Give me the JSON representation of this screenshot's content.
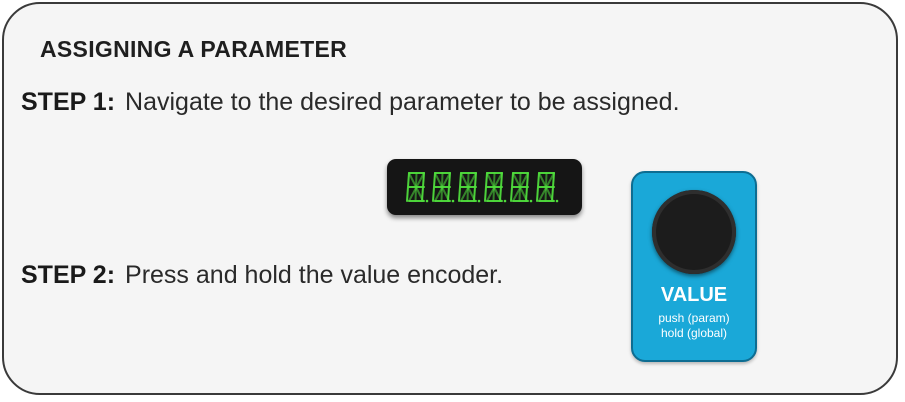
{
  "title": "ASSIGNING A PARAMETER",
  "steps": [
    {
      "label": "STEP 1:",
      "text": "Navigate to the desired parameter to be assigned."
    },
    {
      "label": "STEP 2:",
      "text": "Press and hold the value encoder."
    }
  ],
  "display": {
    "icon": "led-segment-display",
    "color": "#4fdc3c"
  },
  "encoder_module": {
    "title": "VALUE",
    "line1": "push (param)",
    "line2": "hold (global)",
    "color": "#1aa8d8"
  }
}
